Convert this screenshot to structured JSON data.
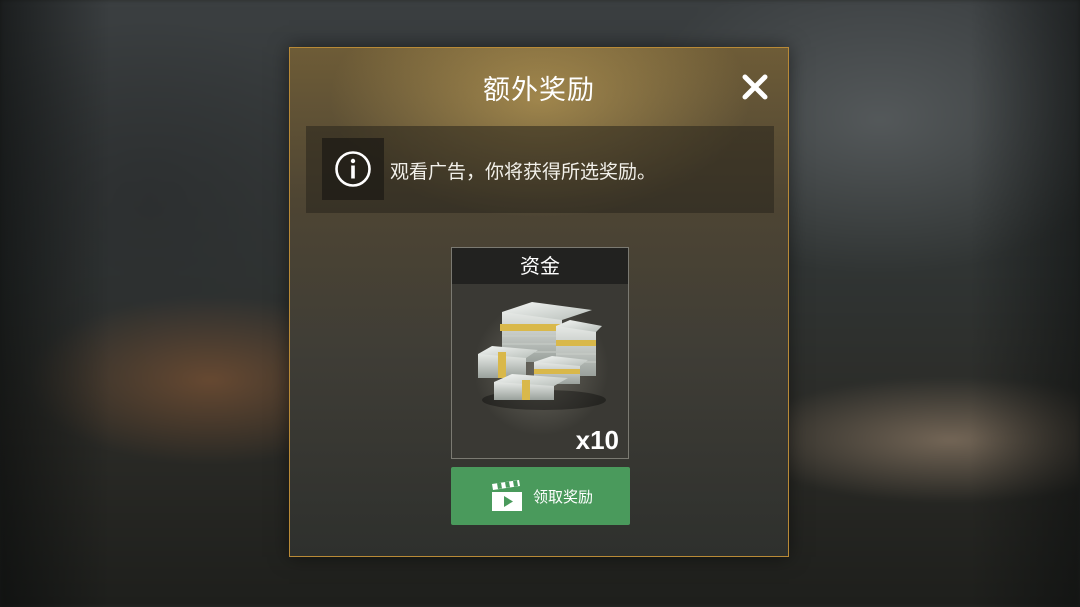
{
  "dialog": {
    "title": "额外奖励",
    "close_icon": "close-icon",
    "info": {
      "icon": "info-icon",
      "text": "观看广告，你将获得所选奖励。"
    },
    "reward": {
      "name": "资金",
      "image": "cash-stacks",
      "quantity": "x10"
    },
    "claim_button": {
      "icon": "clapperboard-icon",
      "label": "领取奖励",
      "color": "#4a9a5c"
    }
  },
  "colors": {
    "dialog_border": "#b98a37",
    "accent_green": "#4a9a5c"
  }
}
